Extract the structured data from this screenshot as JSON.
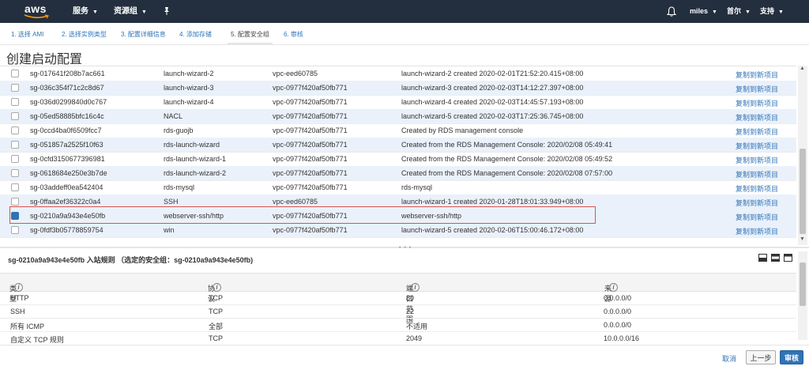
{
  "topbar": {
    "logo": "aws",
    "services": "服务",
    "resource_groups": "资源组",
    "user": "miles",
    "region": "首尔",
    "support": "支持"
  },
  "steps": [
    "1. 选择 AMI",
    "2. 选择实例类型",
    "3. 配置详细信息",
    "4. 添加存储",
    "5. 配置安全组",
    "6. 审核"
  ],
  "page_title": "创建启动配置",
  "security_groups": [
    {
      "id": "sg-017641f208b7ac661",
      "name": "launch-wizard-2",
      "vpc": "vpc-eed60785",
      "desc": "launch-wizard-2 created 2020-02-01T21:52:20.415+08:00",
      "copy": "复制到新项目"
    },
    {
      "id": "sg-036c354f71c2c8d67",
      "name": "launch-wizard-3",
      "vpc": "vpc-0977f420af50fb771",
      "desc": "launch-wizard-3 created 2020-02-03T14:12:27.397+08:00",
      "copy": "复制到新项目"
    },
    {
      "id": "sg-036d0299840d0c767",
      "name": "launch-wizard-4",
      "vpc": "vpc-0977f420af50fb771",
      "desc": "launch-wizard-4 created 2020-02-03T14:45:57.193+08:00",
      "copy": "复制到新项目"
    },
    {
      "id": "sg-05ed58885bfc16c4c",
      "name": "NACL",
      "vpc": "vpc-0977f420af50fb771",
      "desc": "launch-wizard-5 created 2020-02-03T17:25:36.745+08:00",
      "copy": "复制到新项目"
    },
    {
      "id": "sg-0ccd4ba0f6509fcc7",
      "name": "rds-guojb",
      "vpc": "vpc-0977f420af50fb771",
      "desc": "Created by RDS management console",
      "copy": "复制到新项目"
    },
    {
      "id": "sg-051857a2525f10f63",
      "name": "rds-launch-wizard",
      "vpc": "vpc-0977f420af50fb771",
      "desc": "Created from the RDS Management Console: 2020/02/08 05:49:41",
      "copy": "复制到新项目"
    },
    {
      "id": "sg-0cfd3150677396981",
      "name": "rds-launch-wizard-1",
      "vpc": "vpc-0977f420af50fb771",
      "desc": "Created from the RDS Management Console: 2020/02/08 05:49:52",
      "copy": "复制到新项目"
    },
    {
      "id": "sg-0618684e250e3b7de",
      "name": "rds-launch-wizard-2",
      "vpc": "vpc-0977f420af50fb771",
      "desc": "Created from the RDS Management Console: 2020/02/08 07:57:00",
      "copy": "复制到新项目"
    },
    {
      "id": "sg-03addeff0ea542404",
      "name": "rds-mysql",
      "vpc": "vpc-0977f420af50fb771",
      "desc": "rds-mysql",
      "copy": "复制到新项目"
    },
    {
      "id": "sg-0ffaa2ef36322c0a4",
      "name": "SSH",
      "vpc": "vpc-eed60785",
      "desc": "launch-wizard-1 created 2020-01-28T18:01:33.949+08:00",
      "copy": "复制到新项目"
    },
    {
      "id": "sg-0210a9a943e4e50fb",
      "name": "webserver-ssh/http",
      "vpc": "vpc-0977f420af50fb771",
      "desc": "webserver-ssh/http",
      "copy": "复制到新项目",
      "selected": true
    },
    {
      "id": "sg-0fdf3b05778859754",
      "name": "win",
      "vpc": "vpc-0977f420af50fb771",
      "desc": "launch-wizard-5 created 2020-02-06T15:00:46.172+08:00",
      "copy": "复制到新项目"
    }
  ],
  "rules": {
    "title": "sg-0210a9a943e4e50fb 入站规则 （选定的安全组：sg-0210a9a943e4e50fb)",
    "headers": [
      "类型",
      "协议",
      "端口范围",
      "来源"
    ],
    "info_glyph": "i",
    "rows": [
      [
        "HTTP",
        "TCP",
        "80",
        "0.0.0.0/0"
      ],
      [
        "SSH",
        "TCP",
        "22",
        "0.0.0.0/0"
      ],
      [
        "所有 ICMP",
        "全部",
        "不适用",
        "0.0.0.0/0"
      ],
      [
        "自定义 TCP 规则",
        "TCP",
        "2049",
        "10.0.0.0/16"
      ]
    ]
  },
  "footer": {
    "cancel": "取消",
    "previous": "上一步",
    "review": "审核"
  },
  "colors": {
    "topbar": "#232f3e",
    "link": "#2f73b7",
    "selected_outline": "#d9534f",
    "row_alt": "#eaf1fa"
  }
}
